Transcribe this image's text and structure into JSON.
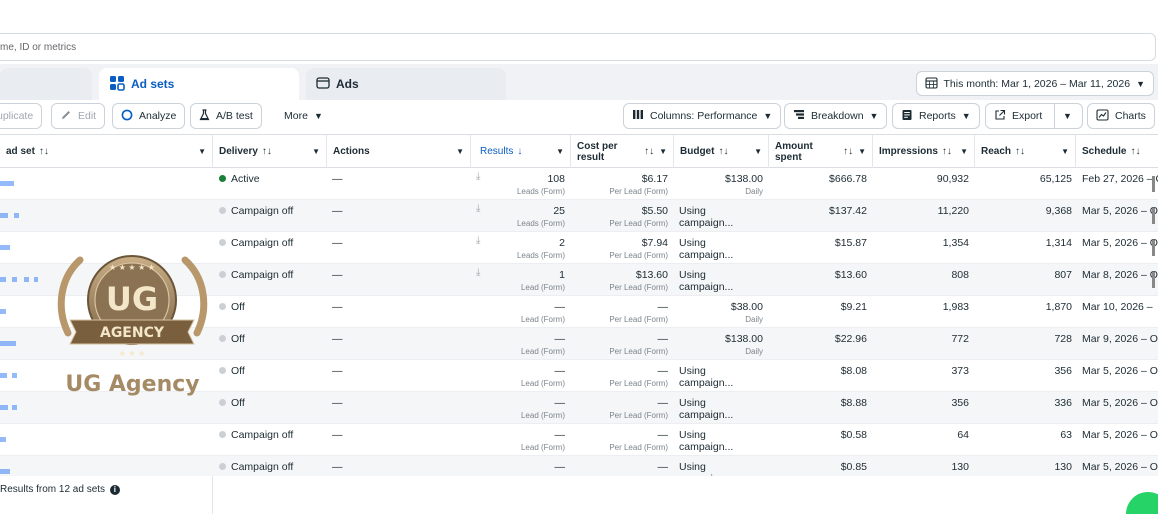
{
  "search": {
    "placeholder": "me, ID or metrics"
  },
  "tabs": [
    {
      "label": ""
    },
    {
      "label": "Ad sets"
    },
    {
      "label": "Ads"
    }
  ],
  "date_range": {
    "label": "This month: Mar 1, 2026 – Mar 11, 2026"
  },
  "toolbar": {
    "duplicate": "uplicate",
    "edit": "Edit",
    "analyze": "Analyze",
    "ab_test": "A/B test",
    "more": "More",
    "columns": "Columns: Performance",
    "breakdown": "Breakdown",
    "reports": "Reports",
    "export": "Export",
    "charts": "Charts"
  },
  "columns": {
    "adset": "ad set",
    "delivery": "Delivery",
    "actions": "Actions",
    "results": "Results",
    "cost_per_result": "Cost per result",
    "budget": "Budget",
    "amount_spent": "Amount spent",
    "impressions": "Impressions",
    "reach": "Reach",
    "schedule": "Schedule"
  },
  "rows": [
    {
      "delivery": "Active",
      "active": true,
      "actions": "—",
      "results": "108",
      "results_sub": "Leads (Form)",
      "cost": "$6.17",
      "cost_sub": "Per Lead (Form)",
      "budget": "$138.00",
      "budget_sub": "Daily",
      "spent": "$666.78",
      "impressions": "90,932",
      "reach": "65,125",
      "schedule": "Feb 27, 2026 – O",
      "download": true
    },
    {
      "delivery": "Campaign off",
      "active": false,
      "actions": "—",
      "results": "25",
      "results_sub": "Leads (Form)",
      "cost": "$5.50",
      "cost_sub": "Per Lead (Form)",
      "budget": "Using campaign...",
      "budget_sub": "",
      "spent": "$137.42",
      "impressions": "11,220",
      "reach": "9,368",
      "schedule": "Mar 5, 2026 – O",
      "download": true
    },
    {
      "delivery": "Campaign off",
      "active": false,
      "actions": "—",
      "results": "2",
      "results_sub": "Leads (Form)",
      "cost": "$7.94",
      "cost_sub": "Per Lead (Form)",
      "budget": "Using campaign...",
      "budget_sub": "",
      "spent": "$15.87",
      "impressions": "1,354",
      "reach": "1,314",
      "schedule": "Mar 5, 2026 – O",
      "download": true
    },
    {
      "delivery": "Campaign off",
      "active": false,
      "actions": "—",
      "results": "1",
      "results_sub": "Lead (Form)",
      "cost": "$13.60",
      "cost_sub": "Per Lead (Form)",
      "budget": "Using campaign...",
      "budget_sub": "",
      "spent": "$13.60",
      "impressions": "808",
      "reach": "807",
      "schedule": "Mar 8, 2026 – O",
      "download": true
    },
    {
      "delivery": "Off",
      "active": false,
      "actions": "—",
      "results": "—",
      "results_sub": "Lead (Form)",
      "cost": "—",
      "cost_sub": "Per Lead (Form)",
      "budget": "$38.00",
      "budget_sub": "Daily",
      "spent": "$9.21",
      "impressions": "1,983",
      "reach": "1,870",
      "schedule": "Mar 10, 2026 –",
      "download": false
    },
    {
      "delivery": "Off",
      "active": false,
      "actions": "—",
      "results": "—",
      "results_sub": "Lead (Form)",
      "cost": "—",
      "cost_sub": "Per Lead (Form)",
      "budget": "$138.00",
      "budget_sub": "Daily",
      "spent": "$22.96",
      "impressions": "772",
      "reach": "728",
      "schedule": "Mar 9, 2026 – O",
      "download": false
    },
    {
      "delivery": "Off",
      "active": false,
      "actions": "—",
      "results": "—",
      "results_sub": "Lead (Form)",
      "cost": "—",
      "cost_sub": "Per Lead (Form)",
      "budget": "Using campaign...",
      "budget_sub": "",
      "spent": "$8.08",
      "impressions": "373",
      "reach": "356",
      "schedule": "Mar 5, 2026 – O",
      "download": false
    },
    {
      "delivery": "Off",
      "active": false,
      "actions": "—",
      "results": "—",
      "results_sub": "Lead (Form)",
      "cost": "—",
      "cost_sub": "Per Lead (Form)",
      "budget": "Using campaign...",
      "budget_sub": "",
      "spent": "$8.88",
      "impressions": "356",
      "reach": "336",
      "schedule": "Mar 5, 2026 – O",
      "download": false
    },
    {
      "delivery": "Campaign off",
      "active": false,
      "actions": "—",
      "results": "—",
      "results_sub": "Lead (Form)",
      "cost": "—",
      "cost_sub": "Per Lead (Form)",
      "budget": "Using campaign...",
      "budget_sub": "",
      "spent": "$0.58",
      "impressions": "64",
      "reach": "63",
      "schedule": "Mar 5, 2026 – Or",
      "download": false
    },
    {
      "delivery": "Campaign off",
      "active": false,
      "actions": "—",
      "results": "—",
      "results_sub": "",
      "cost": "—",
      "cost_sub": "",
      "budget": "Using campaign...",
      "budget_sub": "",
      "spent": "$0.85",
      "impressions": "130",
      "reach": "130",
      "schedule": "Mar 5, 2026 – Or",
      "download": false
    }
  ],
  "footer": {
    "label": "Results from 12 ad sets"
  },
  "watermark": {
    "text": "UG Agency",
    "badge_text_top": "UG",
    "badge_text_ribbon": "AGENCY"
  },
  "colors": {
    "accent": "#0a5dc2",
    "active": "#1a7f37",
    "watermark": "#a58a66"
  },
  "icons": {
    "adsets_tab": "grid-icon",
    "ads_tab": "ad-frame-icon",
    "calendar": "calendar-icon",
    "edit": "pencil-icon",
    "analyze": "circle-icon",
    "ab_test": "flask-icon",
    "columns": "columns-icon",
    "breakdown": "breakdown-icon",
    "reports": "report-icon",
    "export": "export-icon",
    "charts": "chart-icon",
    "download": "download-icon",
    "info": "info-icon"
  }
}
